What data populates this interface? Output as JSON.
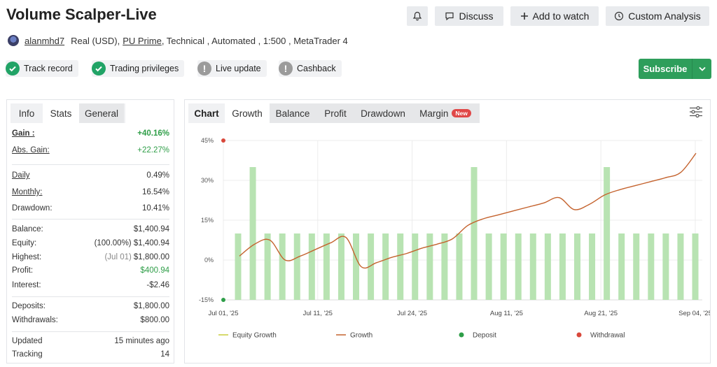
{
  "header": {
    "title": "Volume Scalper-Live",
    "discuss_label": "Discuss",
    "watch_label": "Add to watch",
    "analysis_label": "Custom Analysis"
  },
  "meta": {
    "username": "alanmhd7",
    "account_type": "Real (USD),",
    "broker": "PU Prime",
    "details": ", Technical , Automated , 1:500 , MetaTrader 4"
  },
  "badges": [
    {
      "label": "Track record",
      "status": "ok"
    },
    {
      "label": "Trading privileges",
      "status": "ok"
    },
    {
      "label": "Live update",
      "status": "no"
    },
    {
      "label": "Cashback",
      "status": "no"
    }
  ],
  "subscribe_label": "Subscribe",
  "left_tabs": {
    "info": "Info",
    "stats": "Stats",
    "general": "General"
  },
  "stats": {
    "gain": {
      "label": "Gain :",
      "value": "+40.16%"
    },
    "abs_gain": {
      "label": "Abs. Gain:",
      "value": "+22.27%"
    },
    "daily": {
      "label": "Daily",
      "value": "0.49%"
    },
    "monthly": {
      "label": "Monthly:",
      "value": "16.54%"
    },
    "drawdown": {
      "label": "Drawdown:",
      "value": "10.41%"
    },
    "balance": {
      "label": "Balance:",
      "value": "$1,400.94"
    },
    "equity": {
      "label": "Equity:",
      "pct": "(100.00%)",
      "value": "$1,400.94"
    },
    "highest": {
      "label": "Highest:",
      "date": "(Jul 01)",
      "value": "$1,800.00"
    },
    "profit": {
      "label": "Profit:",
      "value": "$400.94"
    },
    "interest": {
      "label": "Interest:",
      "value": "-$2.46"
    },
    "deposits": {
      "label": "Deposits:",
      "value": "$1,800.00"
    },
    "withdrawals": {
      "label": "Withdrawals:",
      "value": "$800.00"
    },
    "updated": {
      "label": "Updated",
      "value": "15 minutes ago"
    },
    "tracking": {
      "label": "Tracking",
      "value": "14"
    }
  },
  "chart_tabs": {
    "chart": "Chart",
    "growth": "Growth",
    "balance": "Balance",
    "profit": "Profit",
    "drawdown": "Drawdown",
    "margin": "Margin",
    "new_badge": "New"
  },
  "colors": {
    "accent_green": "#2e9e5b",
    "bar": "#b8e3b2",
    "growth_line": "#c4622d",
    "equity_line": "#c8cc3a",
    "deposit": "#2e9e48",
    "withdrawal": "#d9483b"
  },
  "chart_data": {
    "type": "bar",
    "x_tick_labels": [
      "Jul 01, '25",
      "Jul 11, '25",
      "Jul 24, '25",
      "Aug 11, '25",
      "Aug 21, '25",
      "Sep 04, '25"
    ],
    "y_tick_labels": [
      "45%",
      "30%",
      "15%",
      "0%",
      "-15%"
    ],
    "ylim": [
      -15,
      45
    ],
    "grid": true,
    "legend_position": "bottom",
    "legend": [
      "Equity Growth",
      "Growth",
      "Deposit",
      "Withdrawal"
    ],
    "bar_values": [
      10,
      35,
      10,
      10,
      10,
      10,
      10,
      10,
      10,
      10,
      10,
      10,
      10,
      10,
      10,
      10,
      35,
      10,
      10,
      10,
      10,
      10,
      10,
      10,
      10,
      35,
      10,
      10,
      10,
      10,
      10,
      10
    ],
    "series": [
      {
        "name": "Growth",
        "values": [
          1.5,
          6.0,
          7.5,
          0.0,
          1.5,
          4.0,
          6.5,
          8.5,
          -2.5,
          -1.0,
          1.0,
          2.5,
          4.5,
          6.0,
          8.0,
          13.0,
          15.5,
          17.0,
          18.5,
          20.0,
          21.5,
          23.5,
          19.0,
          21.0,
          24.5,
          26.5,
          28.0,
          29.5,
          31.0,
          33.0,
          40.2
        ]
      }
    ],
    "deposits": [
      {
        "at": "Jul 01, '25",
        "value": -15
      }
    ],
    "withdrawals": [
      {
        "at": "Jul 01, '25",
        "value": 45
      }
    ]
  }
}
